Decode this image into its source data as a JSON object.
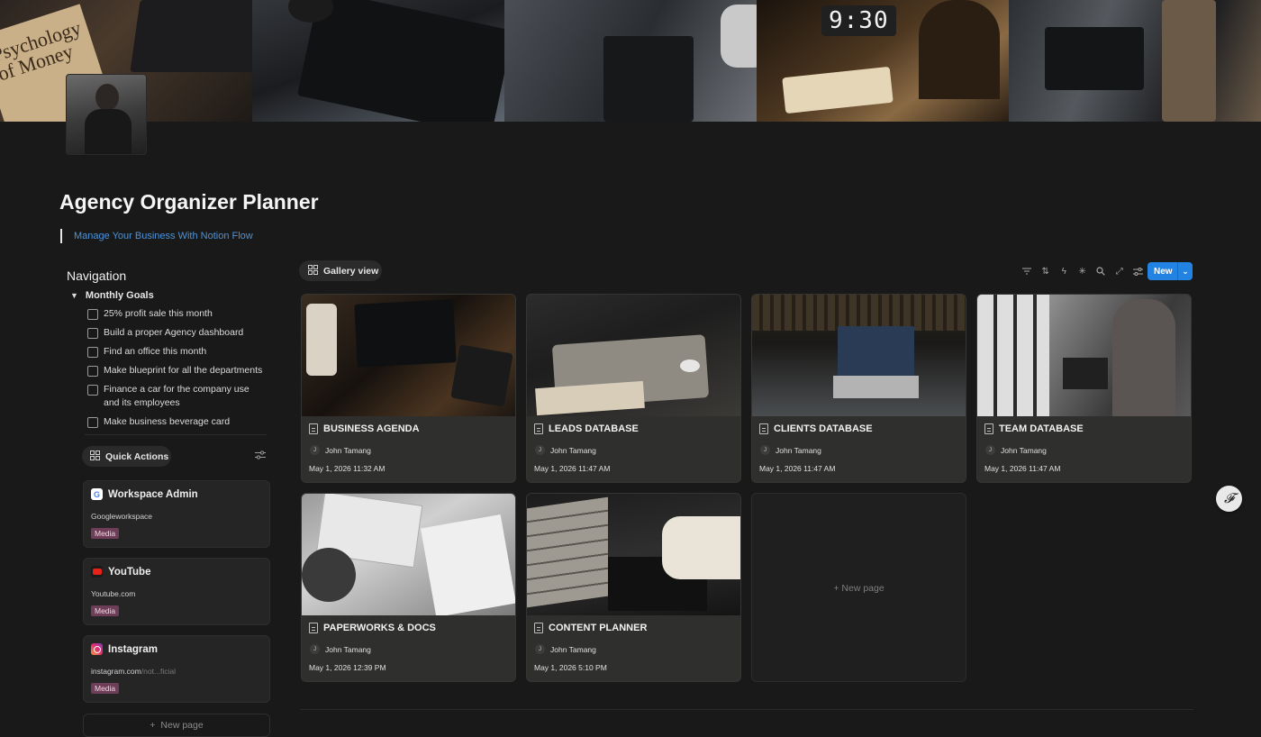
{
  "cover": {
    "book_text": "Psychology of Money",
    "clock_text": "9:30"
  },
  "page": {
    "title": "Agency Organizer Planner",
    "quote": "Manage Your Business With Notion Flow"
  },
  "navigation": {
    "title": "Navigation",
    "toggle_label": "Monthly Goals",
    "todos": [
      "25% profit sale this month",
      "Build a proper Agency dashboard",
      "Find an office this month",
      "Make blueprint for all the departments",
      "Finance a car for the company use and its employees",
      "Make business beverage card"
    ]
  },
  "quick_actions": {
    "label": "Quick Actions",
    "items": [
      {
        "name": "Workspace Admin",
        "url": "Googleworkspace",
        "url_muted": "",
        "tag": "Media",
        "icon": "google-icon"
      },
      {
        "name": "YouTube",
        "url": "Youtube.com",
        "url_muted": "",
        "tag": "Media",
        "icon": "youtube-icon"
      },
      {
        "name": "Instagram",
        "url": "instagram.com",
        "url_muted": "/not...ficial",
        "tag": "Media",
        "icon": "instagram-icon"
      }
    ],
    "new_page": "New page"
  },
  "gallery": {
    "view_label": "Gallery view",
    "new_button": "New",
    "new_page": "New page",
    "accent": "#2383e2",
    "cards": [
      {
        "title": "BUSINESS AGENDA",
        "person": "John Tamang",
        "initial": "J",
        "date": "May 1, 2026 11:32 AM"
      },
      {
        "title": "LEADS DATABASE",
        "person": "John Tamang",
        "initial": "J",
        "date": "May 1, 2026 11:47 AM"
      },
      {
        "title": "CLIENTS DATABASE",
        "person": "John Tamang",
        "initial": "J",
        "date": "May 1, 2026 11:47 AM"
      },
      {
        "title": "TEAM DATABASE",
        "person": "John Tamang",
        "initial": "J",
        "date": "May 1, 2026 11:47 AM"
      },
      {
        "title": "PAPERWORKS & DOCS",
        "person": "John Tamang",
        "initial": "J",
        "date": "May 1, 2026 12:39 PM"
      },
      {
        "title": "CONTENT PLANNER",
        "person": "John Tamang",
        "initial": "J",
        "date": "May 1, 2026 5:10 PM"
      }
    ]
  }
}
